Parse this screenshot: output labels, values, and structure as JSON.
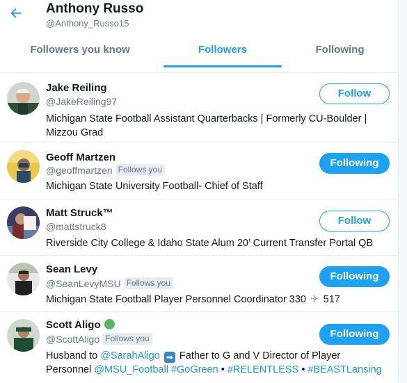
{
  "header": {
    "title": "Anthony Russo",
    "subtitle": "@Anthony_Russo15"
  },
  "tabs": [
    {
      "label": "Followers you know",
      "active": false
    },
    {
      "label": "Followers",
      "active": true
    },
    {
      "label": "Following",
      "active": false
    }
  ],
  "colors": {
    "accent": "#1da1f2",
    "text": "#14171a",
    "muted": "#657786",
    "verified": "#5cb85c"
  },
  "users": [
    {
      "name": "Jake Reiling",
      "handle": "@JakeReiling97",
      "follows_you": "",
      "bio": "Michigan State Football Assistant Quarterbacks | Formerly CU-Boulder | Mizzou Grad",
      "button": "Follow"
    },
    {
      "name": "Geoff Martzen",
      "handle": "@geoffmartzen",
      "follows_you": "Follows you",
      "bio": "Michigan State University Football- Chief of Staff",
      "button": "Following"
    },
    {
      "name": "Matt Struck™",
      "handle": "@mattstruck8",
      "follows_you": "",
      "bio": "Riverside City College & Idaho State Alum 20’ Current Transfer Portal QB",
      "button": "Follow"
    },
    {
      "name": "Sean Levy",
      "handle": "@SeanLevyMSU",
      "follows_you": "Follows you",
      "bio_parts": [
        "Michigan State Football Player Personnel Coordinator 330",
        "517"
      ],
      "bio_icon": "airplane-emoji",
      "button": "Following"
    },
    {
      "name": "Scott Aligo",
      "name_icon": "green-circle-emoji",
      "handle": "@ScottAligo",
      "follows_you": "Follows you",
      "bio_parts": {
        "p1": "Husband to ",
        "link1": "@SarahAligo",
        "p2": " Father to G and V Director of Player Personnel ",
        "link2": "@MSU_Football",
        "sp1": " ",
        "link3": "#GoGreen",
        "p3": " • ",
        "link4": "#RELENTLESS",
        "p4": " • ",
        "link5": "#BEASTLansing"
      },
      "bio_icon": "right-arrow-emoji",
      "button": "Following"
    }
  ]
}
